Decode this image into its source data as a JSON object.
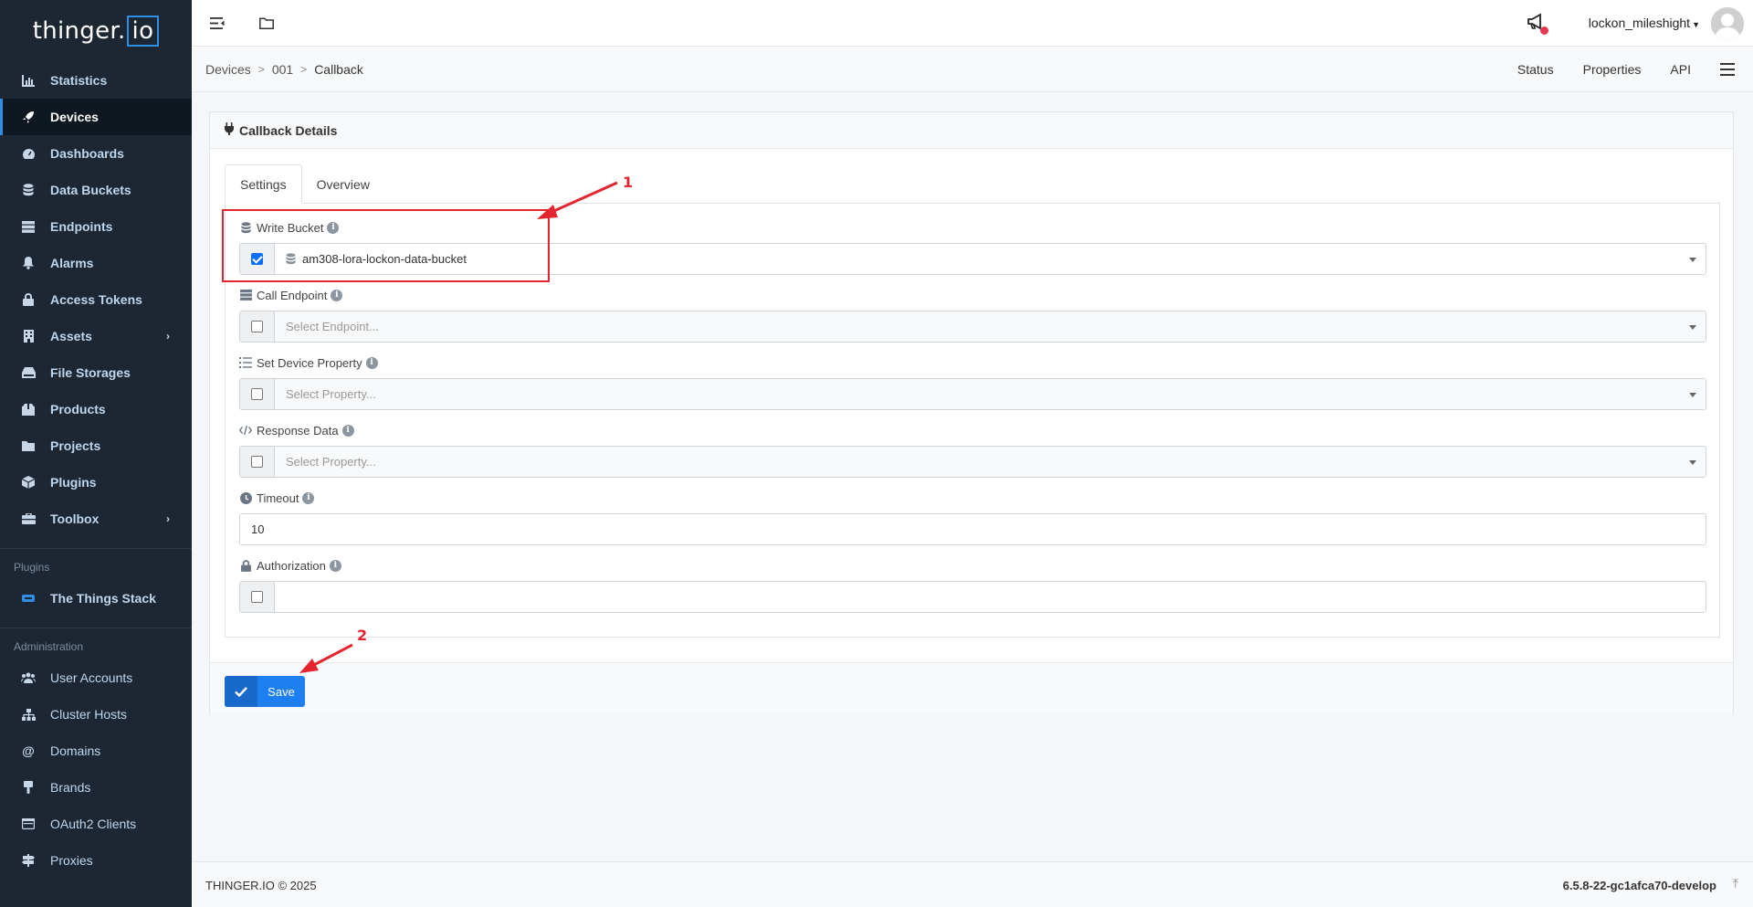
{
  "brand": {
    "logo_main": "thinger.",
    "logo_io": "io"
  },
  "sidebar": {
    "items": [
      {
        "label": "Statistics",
        "icon": "chart-icon"
      },
      {
        "label": "Devices",
        "icon": "rocket-icon",
        "active": true
      },
      {
        "label": "Dashboards",
        "icon": "gauge-icon"
      },
      {
        "label": "Data Buckets",
        "icon": "database-icon"
      },
      {
        "label": "Endpoints",
        "icon": "endpoint-icon"
      },
      {
        "label": "Alarms",
        "icon": "bell-icon"
      },
      {
        "label": "Access Tokens",
        "icon": "lock-icon"
      },
      {
        "label": "Assets",
        "icon": "building-icon",
        "has_children": true
      },
      {
        "label": "File Storages",
        "icon": "hdd-icon"
      },
      {
        "label": "Products",
        "icon": "box-icon"
      },
      {
        "label": "Projects",
        "icon": "folder-icon"
      },
      {
        "label": "Plugins",
        "icon": "cube-icon"
      },
      {
        "label": "Toolbox",
        "icon": "toolbox-icon",
        "has_children": true
      }
    ],
    "plugins_label": "Plugins",
    "plugins": [
      {
        "label": "The Things Stack",
        "icon": "ttn-icon"
      }
    ],
    "admin_label": "Administration",
    "admin": [
      {
        "label": "User Accounts",
        "icon": "users-icon"
      },
      {
        "label": "Cluster Hosts",
        "icon": "sitemap-icon"
      },
      {
        "label": "Domains",
        "icon": "at-icon"
      },
      {
        "label": "Brands",
        "icon": "brush-icon"
      },
      {
        "label": "OAuth2 Clients",
        "icon": "window-icon"
      },
      {
        "label": "Proxies",
        "icon": "signs-icon"
      }
    ]
  },
  "topbar": {
    "username": "lockon_mileshight"
  },
  "breadcrumb": {
    "items": [
      "Devices",
      "001",
      "Callback"
    ],
    "links": [
      "Status",
      "Properties",
      "API"
    ]
  },
  "card": {
    "title": "Callback Details",
    "tabs": [
      "Settings",
      "Overview"
    ],
    "fields": {
      "write_bucket": {
        "label": "Write Bucket",
        "checked": true,
        "value": "am308-lora-lockon-data-bucket"
      },
      "call_endpoint": {
        "label": "Call Endpoint",
        "checked": false,
        "placeholder": "Select Endpoint..."
      },
      "set_property": {
        "label": "Set Device Property",
        "checked": false,
        "placeholder": "Select Property..."
      },
      "response_data": {
        "label": "Response Data",
        "checked": false,
        "placeholder": "Select Property..."
      },
      "timeout": {
        "label": "Timeout",
        "value": "10"
      },
      "authorization": {
        "label": "Authorization",
        "checked": false,
        "value": ""
      }
    },
    "save_label": "Save"
  },
  "annotations": {
    "one": "1",
    "two": "2"
  },
  "footer": {
    "copyright": "THINGER.IO © 2025",
    "version": "6.5.8-22-gc1afca70-develop"
  },
  "colors": {
    "accent": "#1e7ff0",
    "sidebar_bg": "#1c2733",
    "annotation": "#e3252f"
  }
}
